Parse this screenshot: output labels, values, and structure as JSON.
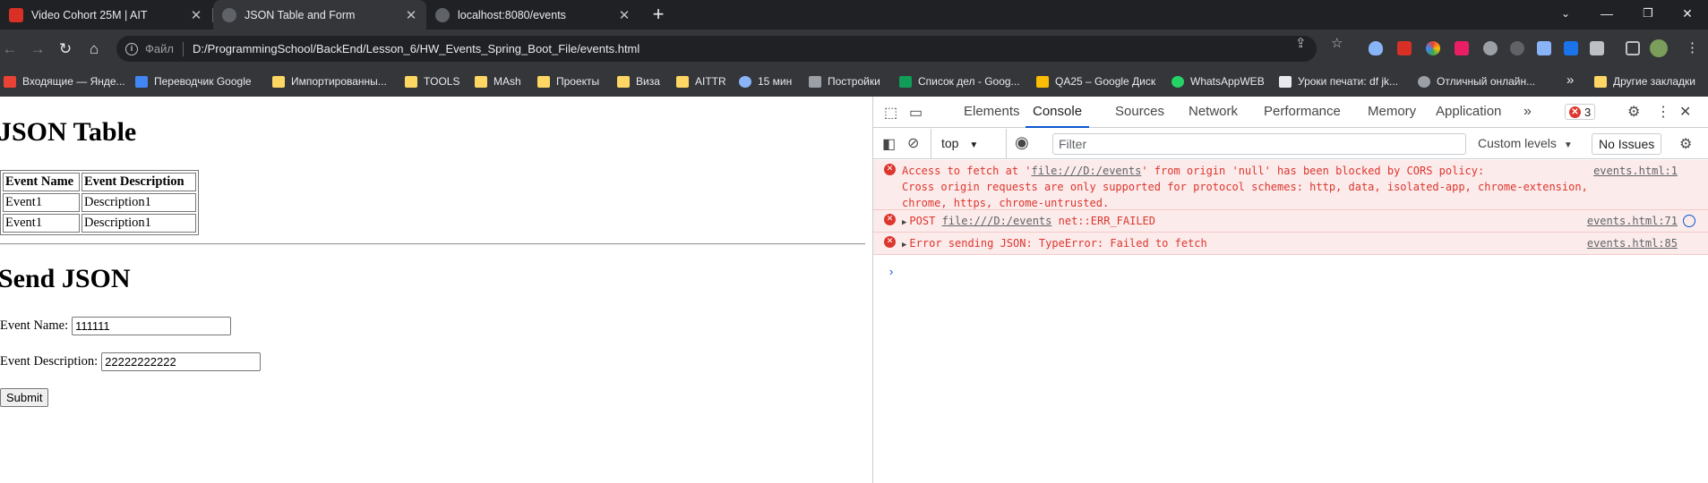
{
  "browser": {
    "tabs": [
      {
        "title": "Video Cohort 25M | AIT",
        "active": false
      },
      {
        "title": "JSON Table and Form",
        "active": true
      },
      {
        "title": "localhost:8080/events",
        "active": false
      }
    ],
    "new_tab_label": "+",
    "address": {
      "scheme_label": "Файл",
      "url": "D:/ProgrammingSchool/BackEnd/Lesson_6/HW_Events_Spring_Boot_File/events.html"
    },
    "bookmarks": [
      {
        "label": "Входящие — Янде...",
        "icon": "mail-icon",
        "color": "#ea4335"
      },
      {
        "label": "Переводчик Google",
        "icon": "translate-icon",
        "color": "#4285f4"
      },
      {
        "label": "Импортированны...",
        "icon": "folder-icon",
        "color": "#fdd663"
      },
      {
        "label": "TOOLS",
        "icon": "folder-icon",
        "color": "#fdd663"
      },
      {
        "label": "MAsh",
        "icon": "folder-icon",
        "color": "#fdd663"
      },
      {
        "label": "Проекты",
        "icon": "folder-icon",
        "color": "#fdd663"
      },
      {
        "label": "Виза",
        "icon": "folder-icon",
        "color": "#fdd663"
      },
      {
        "label": "AITTR",
        "icon": "folder-icon",
        "color": "#fdd663"
      },
      {
        "label": "15 мин",
        "icon": "clock-icon",
        "color": "#8ab4f8"
      },
      {
        "label": "Постройки",
        "icon": "bridge-icon",
        "color": "#e8eaed"
      },
      {
        "label": "Список дел - Goog...",
        "icon": "sheets-icon",
        "color": "#0f9d58"
      },
      {
        "label": "QA25 – Google Диск",
        "icon": "drive-icon",
        "color": "#fbbc04"
      },
      {
        "label": "WhatsAppWEB",
        "icon": "whatsapp-icon",
        "color": "#25d366"
      },
      {
        "label": "Уроки печати: df jk...",
        "icon": "page-icon",
        "color": "#e8eaed"
      },
      {
        "label": "Отличный онлайн...",
        "icon": "globe-icon",
        "color": "#e8eaed"
      }
    ],
    "bookmarks_overflow": "»",
    "other_bookmarks": "Другие закладки"
  },
  "page": {
    "table_heading": "JSON Table",
    "table_headers": [
      "Event Name",
      "Event Description"
    ],
    "table_rows": [
      [
        "Event1",
        "Description1"
      ],
      [
        "Event1",
        "Description1"
      ]
    ],
    "form_heading": "Send JSON",
    "event_name_label": "Event Name:",
    "event_name_value": "111111",
    "event_description_label": "Event Description:",
    "event_description_value": "22222222222",
    "submit_label": "Submit"
  },
  "devtools": {
    "tabs": [
      "Elements",
      "Console",
      "Sources",
      "Network",
      "Performance",
      "Memory",
      "Application"
    ],
    "active_tab": "Console",
    "error_count": "3",
    "context": "top",
    "filter_placeholder": "Filter",
    "levels": "Custom levels",
    "issues": "No Issues",
    "messages": [
      {
        "line1_pre": "Access to fetch at '",
        "line1_link": "file:///D:/events",
        "line1_post": "' from origin 'null' has been blocked by CORS policy:",
        "line2": "Cross origin requests are only supported for protocol schemes: http, data, isolated-app, chrome-extension,",
        "line3": "chrome, https, chrome-untrusted.",
        "source": "events.html:1"
      },
      {
        "method": "POST",
        "link": "file:///D:/events",
        "error": "net::ERR_FAILED",
        "source": "events.html:71"
      },
      {
        "text": "Error sending JSON: TypeError: Failed to fetch",
        "source": "events.html:85"
      }
    ],
    "prompt": "›"
  }
}
